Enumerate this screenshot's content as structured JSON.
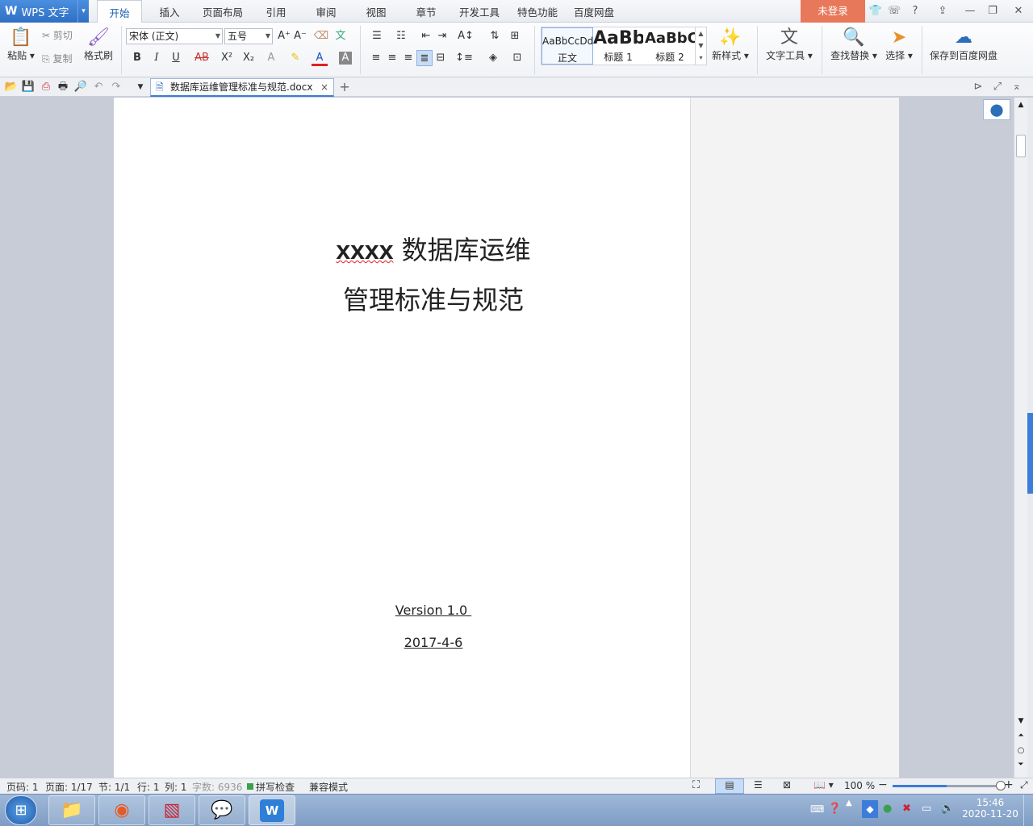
{
  "app": {
    "logo": "W",
    "name": "WPS 文字",
    "menu_caret": "▾"
  },
  "menu_tabs": [
    "开始",
    "插入",
    "页面布局",
    "引用",
    "审阅",
    "视图",
    "章节",
    "开发工具",
    "特色功能",
    "百度网盘"
  ],
  "active_tab": "开始",
  "login_label": "未登录",
  "window_controls": {
    "skin": "👕",
    "help": "?",
    "minimize": "—",
    "restore": "❐",
    "close": "✕"
  },
  "ribbon": {
    "paste": "粘贴",
    "cut": "剪切",
    "copy": "复制",
    "format_painter": "格式刷",
    "font_name": "宋体 (正文)",
    "font_size": "五号",
    "styles": [
      {
        "preview": "AaBbCcDd",
        "name": "正文"
      },
      {
        "preview": "AaBb",
        "name": "标题 1"
      },
      {
        "preview": "AaBbC",
        "name": "标题 2"
      }
    ],
    "new_style": "新样式",
    "text_tools": "文字工具",
    "find_replace": "查找替换",
    "select": "选择",
    "save_baidu": "保存到百度网盘",
    "bold": "B",
    "italic": "I",
    "underline": "U",
    "strike": "AB",
    "superscript": "X²",
    "subscript": "X₂",
    "font_color": "A",
    "char_shade": "A"
  },
  "doc_tab": {
    "title": "数据库运维管理标准与规范.docx",
    "close": "×",
    "new": "+"
  },
  "document": {
    "title_line1_latin": "xxxx",
    "title_line1_cjk": " 数据库运维",
    "title_line2": "管理标准与规范",
    "version": "Version 1.0 ",
    "date": "2017-4-6"
  },
  "status": {
    "page_code": "页码: 1",
    "page": "页面: 1/17",
    "section": "节: 1/1",
    "row": "行: 1",
    "col": "列: 1",
    "words": "字数: 6936",
    "spell": "拼写检查",
    "compat": "兼容模式",
    "zoom": "100 %",
    "zoom_fraction": 0.5
  },
  "taskbar": {
    "time": "15:46",
    "date": "2020-11-20"
  },
  "colors": {
    "accent": "#2f6fc4",
    "login": "#e8785a",
    "page": "#ffffff",
    "workspace": "#c8ccd6"
  }
}
